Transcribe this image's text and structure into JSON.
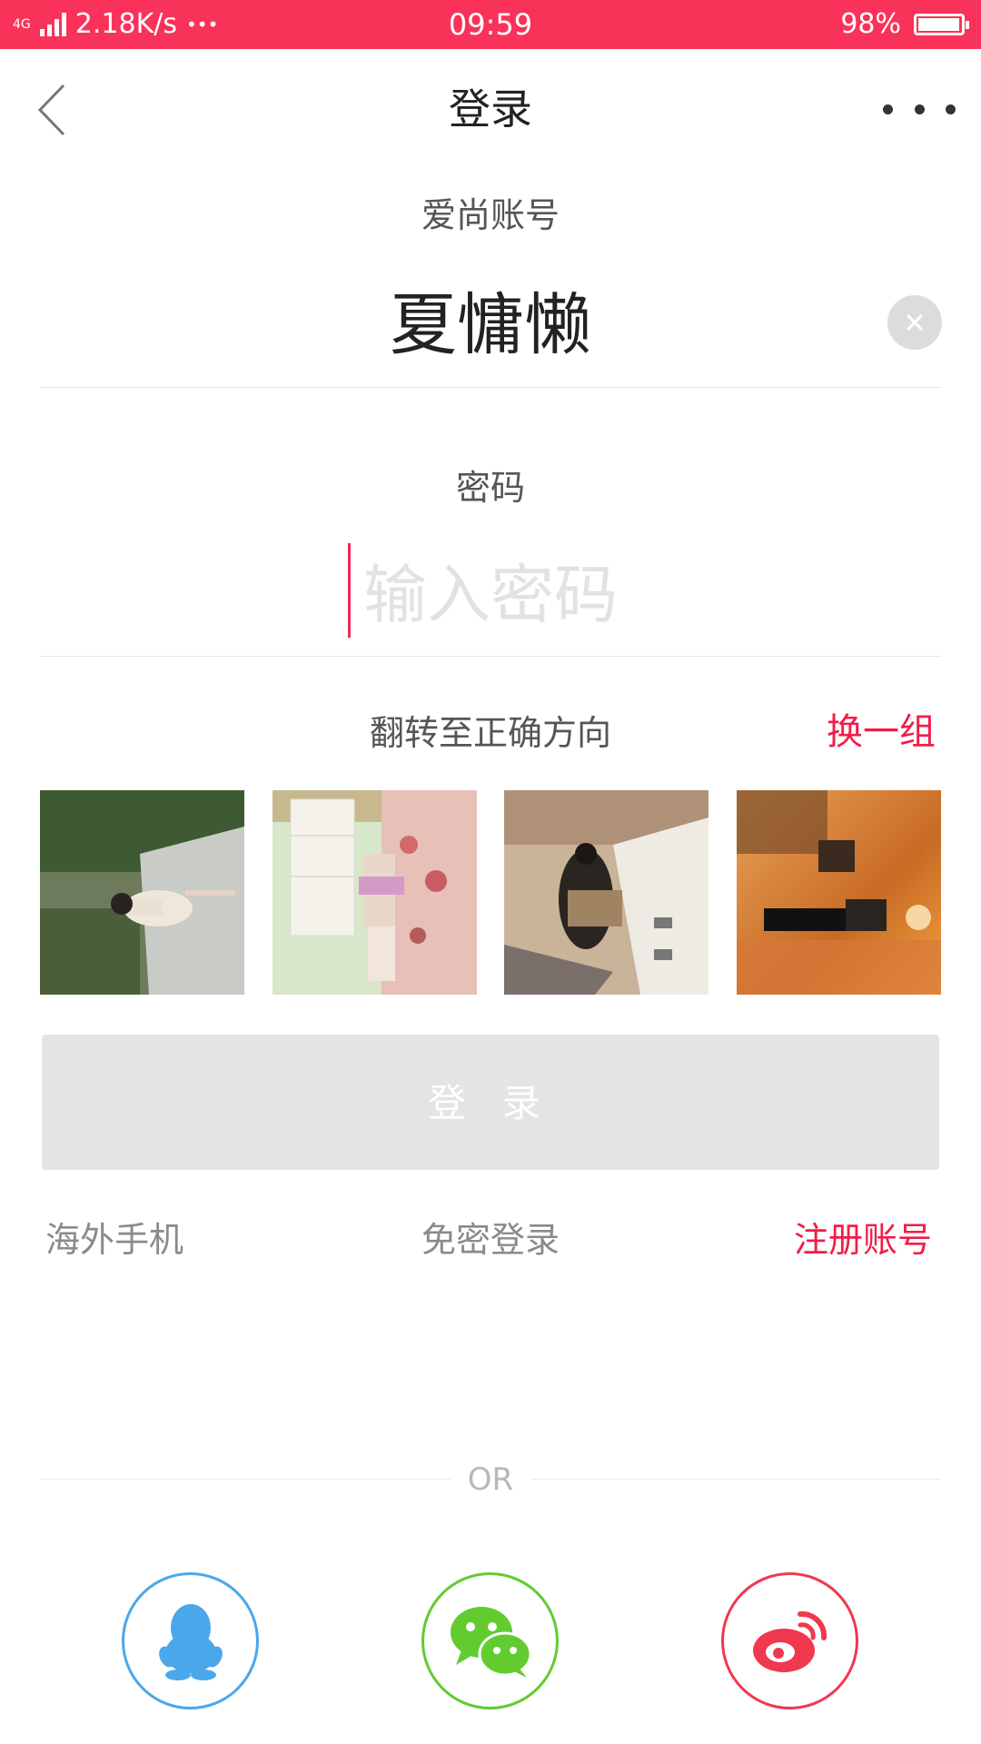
{
  "status_bar": {
    "network_type": "4G",
    "speed": "2.18K/s",
    "more": "•••",
    "time": "09:59",
    "battery": "98%",
    "battery_level": 0.98,
    "background_color": "#f9325a"
  },
  "header": {
    "title": "登录",
    "back_icon": "chevron-left-icon",
    "more_icon": "more-dots-icon"
  },
  "account": {
    "label": "爱尚账号",
    "value": "夏慵懒",
    "clear_icon": "close-circle-icon"
  },
  "password": {
    "label": "密码",
    "placeholder": "输入密码",
    "value": ""
  },
  "captcha": {
    "hint": "翻转至正确方向",
    "refresh_label": "换一组",
    "images": [
      "woman-park-photo",
      "woman-bedroom-photo",
      "woman-cabinet-photo",
      "night-street-photo"
    ]
  },
  "login_button": {
    "label": "登 录",
    "state": "disabled"
  },
  "links": {
    "overseas": "海外手机",
    "passwordless": "免密登录",
    "register": "注册账号"
  },
  "divider_text": "OR",
  "social": [
    {
      "name": "qq",
      "icon": "qq-penguin-icon",
      "color": "#4aa7ea"
    },
    {
      "name": "wechat",
      "icon": "wechat-icon",
      "color": "#62cb30"
    },
    {
      "name": "weibo",
      "icon": "weibo-icon",
      "color": "#f0384e"
    }
  ],
  "accent_color": "#f21c48"
}
